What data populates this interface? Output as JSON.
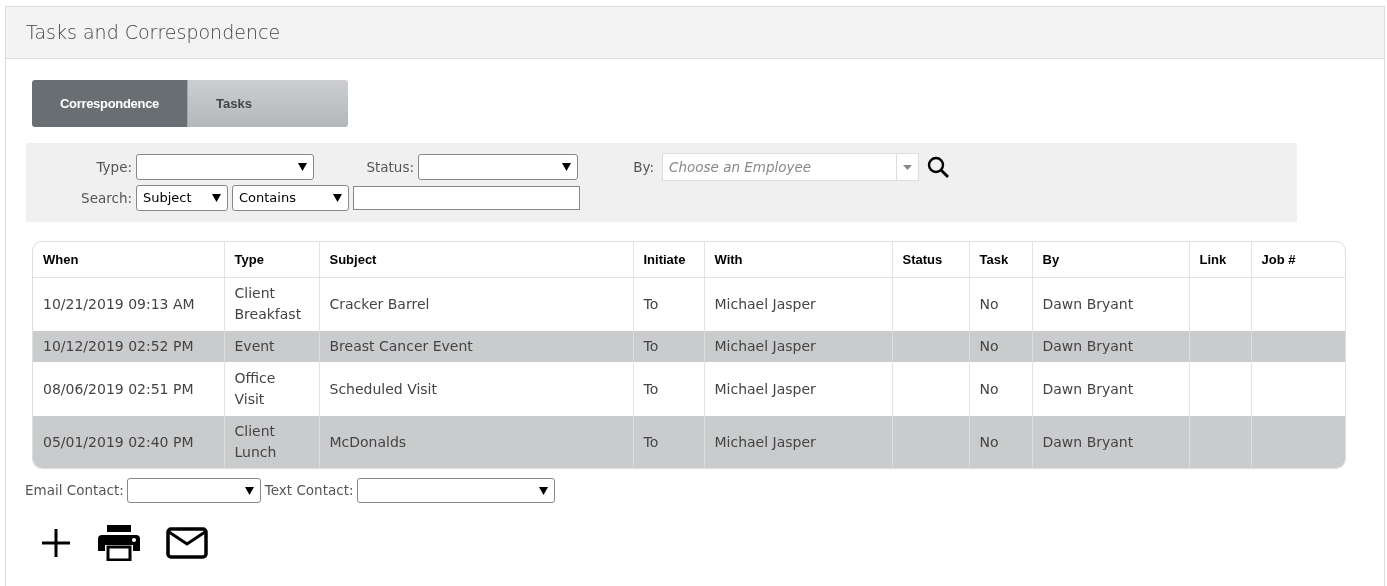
{
  "panel": {
    "title": "Tasks and Correspondence"
  },
  "tabs": [
    {
      "label": "Correspondence",
      "selected": true
    },
    {
      "label": "Tasks",
      "selected": false
    }
  ],
  "filters": {
    "type": {
      "label": "Type:"
    },
    "status": {
      "label": "Status:"
    },
    "by": {
      "label": "By:",
      "placeholder": "Choose an Employee"
    },
    "search": {
      "label": "Search:",
      "field": "Subject",
      "operator": "Contains"
    }
  },
  "table": {
    "columns": [
      "When",
      "Type",
      "Subject",
      "Initiate",
      "With",
      "Status",
      "Task",
      "By",
      "Link",
      "Job #"
    ],
    "rows": [
      [
        "10/21/2019 09:13 AM",
        "Client Breakfast",
        "Cracker Barrel",
        "To",
        "Michael Jasper",
        "",
        "No",
        "Dawn Bryant",
        "",
        ""
      ],
      [
        "10/12/2019 02:52 PM",
        "Event",
        "Breast Cancer Event",
        "To",
        "Michael Jasper",
        "",
        "No",
        "Dawn Bryant",
        "",
        ""
      ],
      [
        "08/06/2019 02:51 PM",
        "Office Visit",
        "Scheduled Visit",
        "To",
        "Michael Jasper",
        "",
        "No",
        "Dawn Bryant",
        "",
        ""
      ],
      [
        "05/01/2019 02:40 PM",
        "Client Lunch",
        "McDonalds",
        "To",
        "Michael Jasper",
        "",
        "No",
        "Dawn Bryant",
        "",
        ""
      ]
    ]
  },
  "contacts": [
    {
      "label": "Email Contact:"
    },
    {
      "label": "Text Contact:"
    }
  ],
  "actions": [
    {
      "kind": "add"
    },
    {
      "kind": "print"
    },
    {
      "kind": "email"
    }
  ]
}
